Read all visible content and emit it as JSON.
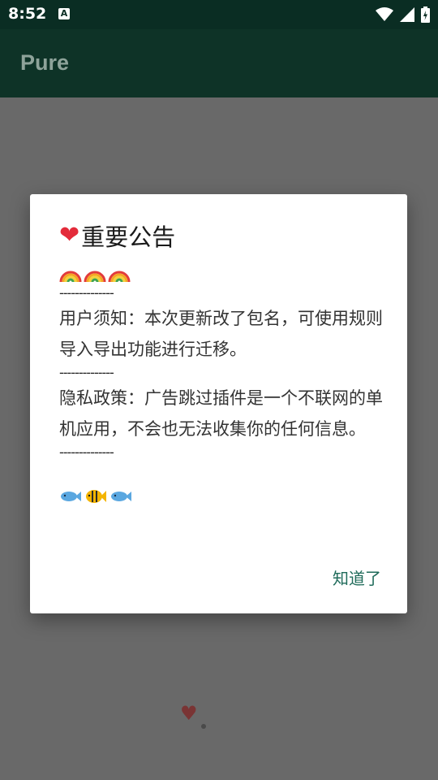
{
  "status_bar": {
    "time": "8:52",
    "notif_icon": "A",
    "icons": [
      "wifi-icon",
      "signal-icon",
      "battery-icon"
    ]
  },
  "app_bar": {
    "title": "Pure"
  },
  "dialog": {
    "title": "重要公告",
    "title_icon": "heart-emoji",
    "emoji_rows": [
      "rainbow",
      "rainbow",
      "rainbow"
    ],
    "separator": "--------------",
    "user_notice": "用户须知：本次更新改了包名，可使用规则导入导出功能进行迁移。",
    "privacy_policy": "隐私政策：广告跳过插件是一个不联网的单机应用，不会也无法收集你的任何信息。",
    "fish_icons": [
      "fish",
      "tropical-fish",
      "fish"
    ],
    "ok_button": "知道了"
  },
  "colors": {
    "status_bar_bg": "#0a2d23",
    "app_bar_bg": "#0e3327",
    "scrim": "#696969",
    "accent": "#1f6b5a",
    "heart": "#e32b3a"
  }
}
